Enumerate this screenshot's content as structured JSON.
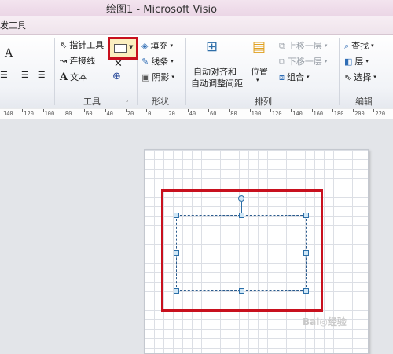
{
  "window": {
    "title": "绘图1  -  Microsoft Visio"
  },
  "ribbon_tab": {
    "label": "发工具"
  },
  "ribbon": {
    "font_icon": "A",
    "tools": {
      "pointer": "指针工具",
      "connector": "连接线",
      "text": "文本",
      "label": "工具"
    },
    "shape_group": {
      "fill": "填充",
      "line": "线条",
      "shadow": "阴影",
      "label": "形状"
    },
    "arrange": {
      "auto_align": "自动对齐和",
      "auto_space": "自动调整间距",
      "position": "位置",
      "bring_forward": "上移一层",
      "send_backward": "下移一层",
      "group": "组合",
      "label": "排列"
    },
    "edit": {
      "find": "查找",
      "layer": "层",
      "select": "选择",
      "label": "编辑"
    }
  },
  "ruler": {
    "labels": [
      "140",
      "120",
      "100",
      "80",
      "60",
      "40",
      "20",
      "0",
      "20",
      "40",
      "60",
      "80",
      "100",
      "120",
      "140",
      "160",
      "180",
      "200",
      "220"
    ]
  },
  "watermark": "Bai◎经验",
  "colors": {
    "highlight": "#c8101e",
    "handle": "#2c6fa8",
    "selected_button_bg": "#fbefbf"
  }
}
